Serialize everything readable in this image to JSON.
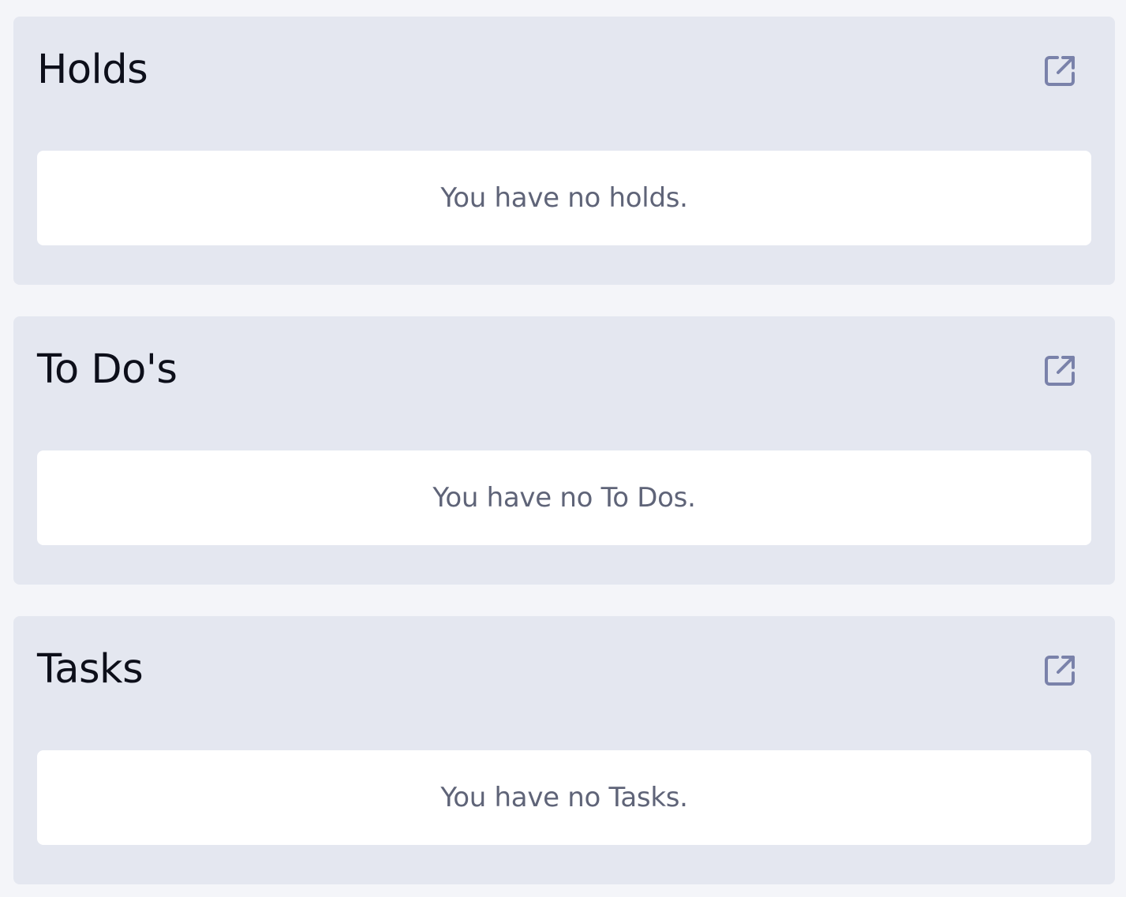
{
  "panels": [
    {
      "title": "Holds",
      "empty_message": "You have no holds.",
      "action_icon": "open-in-new-icon"
    },
    {
      "title": "To Do's",
      "empty_message": "You have no To Dos.",
      "action_icon": "open-in-new-icon"
    },
    {
      "title": "Tasks",
      "empty_message": "You have no Tasks.",
      "action_icon": "open-in-new-icon"
    }
  ],
  "colors": {
    "page_background": "#f4f5f9",
    "panel_background": "#e4e7f0",
    "card_background": "#ffffff",
    "icon_color": "#7a82aa",
    "title_color": "#0d0f1a",
    "message_color": "#5f6478"
  }
}
